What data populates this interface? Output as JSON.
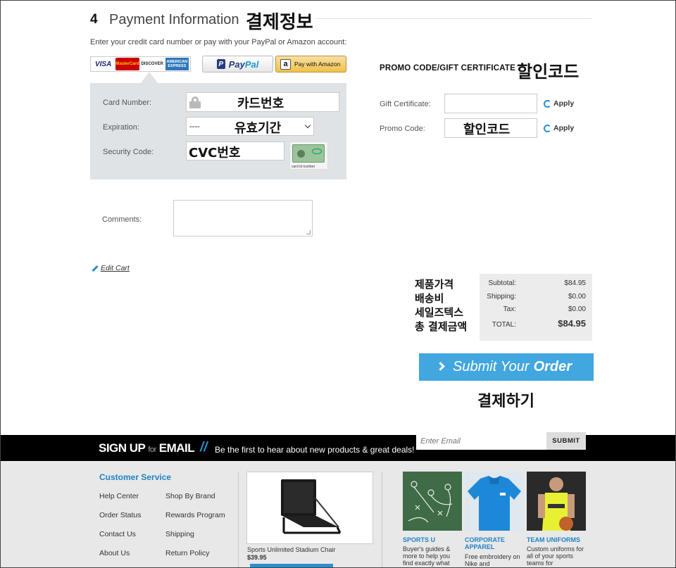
{
  "payment": {
    "step_number": "4",
    "step_title": "Payment Information",
    "step_title_kr": "결제정보",
    "intro": "Enter your credit card number or pay with your PayPal or Amazon account:",
    "card_logos": {
      "visa": "VISA",
      "mastercard": "MasterCard",
      "discover": "DISCOVER",
      "amex": "AMERICAN EXPRESS"
    },
    "paypal": {
      "label_a": "Pay",
      "label_b": "Pal",
      "icon": "paypal-p-icon"
    },
    "amazon": {
      "label": "Pay with Amazon",
      "icon": "amazon-a-icon"
    },
    "card_number": {
      "label": "Card Number:",
      "value_kr": "카드번호",
      "icon": "lock-icon"
    },
    "expiration": {
      "label": "Expiration:",
      "selected": "----",
      "value_kr": "유효기간"
    },
    "security_code": {
      "label": "Security Code:",
      "value_kr": "CVC번호",
      "card_caption": "card id number"
    },
    "comments": {
      "label": "Comments:"
    },
    "edit_cart": "Edit Cart"
  },
  "promo": {
    "heading": "PROMO CODE/GIFT CERTIFICATE",
    "heading_kr": "할인코드",
    "gift": {
      "label": "Gift Certificate:",
      "apply": "Apply"
    },
    "code": {
      "label": "Promo Code:",
      "value_kr": "할인코드",
      "apply": "Apply"
    }
  },
  "totals": {
    "kr_labels": [
      "제품가격",
      "배송비",
      "세일즈텍스",
      "총 결제금액"
    ],
    "subtotal": {
      "label": "Subtotal:",
      "value": "$84.95"
    },
    "shipping": {
      "label": "Shipping:",
      "value": "$0.00"
    },
    "tax": {
      "label": "Tax:",
      "value": "$0.00"
    },
    "total": {
      "label": "TOTAL:",
      "value": "$84.95"
    }
  },
  "submit": {
    "label_a": "Submit Your",
    "label_b": "Order",
    "label_kr": "결제하기"
  },
  "signup": {
    "title_a": "SIGN UP",
    "title_for": "for",
    "title_b": "EMAIL",
    "slashes": "//",
    "tagline": "Be the first to hear about new products & great deals!",
    "email_placeholder": "Enter Email",
    "submit": "SUBMIT"
  },
  "footer": {
    "cs_title": "Customer Service",
    "links_col1": [
      "Help Center",
      "Order Status",
      "Contact Us",
      "About Us"
    ],
    "links_col2": [
      "Shop By Brand",
      "Rewards Program",
      "Shipping",
      "Return Policy"
    ],
    "product": {
      "name": "Sports Unlimited Stadium Chair",
      "price": "$39.95"
    },
    "tiles": [
      {
        "title": "SPORTS U",
        "text": "Buyer's guides & more to help you find exactly what"
      },
      {
        "title": "CORPORATE APPAREL",
        "text": "Free embroidery on Nike and"
      },
      {
        "title": "TEAM UNIFORMS",
        "text": "Custom uniforms for all of your sports teams for"
      }
    ]
  },
  "colors": {
    "accent": "#42a6df",
    "link_blue": "#1f83c6",
    "panel": "#dfe3e6",
    "signup_bg": "#000000"
  }
}
